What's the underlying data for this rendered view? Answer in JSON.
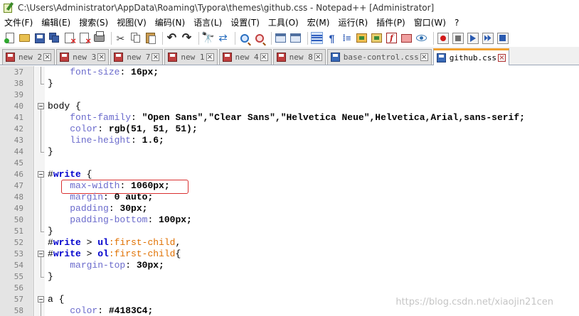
{
  "window": {
    "title": "C:\\Users\\Administrator\\AppData\\Roaming\\Typora\\themes\\github.css - Notepad++ [Administrator]"
  },
  "menu": [
    "文件(F)",
    "编辑(E)",
    "搜索(S)",
    "视图(V)",
    "编码(N)",
    "语言(L)",
    "设置(T)",
    "工具(O)",
    "宏(M)",
    "运行(R)",
    "插件(P)",
    "窗口(W)",
    "?"
  ],
  "tabs": [
    {
      "label": "new 2",
      "saved": false,
      "active": false
    },
    {
      "label": "new 3",
      "saved": false,
      "active": false
    },
    {
      "label": "new 7",
      "saved": false,
      "active": false
    },
    {
      "label": "new 1",
      "saved": false,
      "active": false
    },
    {
      "label": "new 4",
      "saved": false,
      "active": false
    },
    {
      "label": "new 8",
      "saved": false,
      "active": false
    },
    {
      "label": "base-control.css",
      "saved": true,
      "active": false
    },
    {
      "label": "github.css",
      "saved": true,
      "active": true
    }
  ],
  "toolbar_icons": [
    "new-file-icon",
    "open-folder-icon",
    "save-icon",
    "save-all-icon",
    "close-icon",
    "close-all-icon",
    "print-icon",
    "cut-icon",
    "copy-icon",
    "paste-icon",
    "undo-icon",
    "redo-icon",
    "find-icon",
    "replace-icon",
    "zoom-in-icon",
    "zoom-out-icon",
    "sync-vertical-icon",
    "sync-horizontal-icon",
    "word-wrap-icon",
    "show-all-chars-icon",
    "indent-guide-icon",
    "doc-map-icon",
    "function-list-icon",
    "folder-workspace-icon",
    "monitor-icon",
    "record-macro-icon",
    "stop-macro-icon",
    "play-macro-icon",
    "run-macro-multiple-icon",
    "save-macro-icon"
  ],
  "editor": {
    "lines": [
      {
        "n": "37",
        "fold": "line",
        "code": "    font-size: 16px;"
      },
      {
        "n": "38",
        "fold": "end",
        "code": "}"
      },
      {
        "n": "39",
        "fold": "",
        "code": ""
      },
      {
        "n": "40",
        "fold": "open",
        "code": "body {"
      },
      {
        "n": "41",
        "fold": "line",
        "code": "    font-family: \"Open Sans\",\"Clear Sans\",\"Helvetica Neue\",Helvetica,Arial,sans-serif;"
      },
      {
        "n": "42",
        "fold": "line",
        "code": "    color: rgb(51, 51, 51);"
      },
      {
        "n": "43",
        "fold": "line",
        "code": "    line-height: 1.6;"
      },
      {
        "n": "44",
        "fold": "end",
        "code": "}"
      },
      {
        "n": "45",
        "fold": "",
        "code": ""
      },
      {
        "n": "46",
        "fold": "open",
        "code": "#write {"
      },
      {
        "n": "47",
        "fold": "line",
        "code": "    max-width: 1060px;"
      },
      {
        "n": "48",
        "fold": "line",
        "code": "    margin: 0 auto;"
      },
      {
        "n": "49",
        "fold": "line",
        "code": "    padding: 30px;"
      },
      {
        "n": "50",
        "fold": "line",
        "code": "    padding-bottom: 100px;"
      },
      {
        "n": "51",
        "fold": "end",
        "code": "}"
      },
      {
        "n": "52",
        "fold": "",
        "code": "#write > ul:first-child,"
      },
      {
        "n": "53",
        "fold": "open",
        "code": "#write > ol:first-child{"
      },
      {
        "n": "54",
        "fold": "line",
        "code": "    margin-top: 30px;"
      },
      {
        "n": "55",
        "fold": "end",
        "code": "}"
      },
      {
        "n": "56",
        "fold": "",
        "code": ""
      },
      {
        "n": "57",
        "fold": "open",
        "code": "a {"
      },
      {
        "n": "58",
        "fold": "line",
        "code": "    color: #4183C4;"
      }
    ]
  },
  "watermark": "https://blog.csdn.net/xiaojin21cen"
}
